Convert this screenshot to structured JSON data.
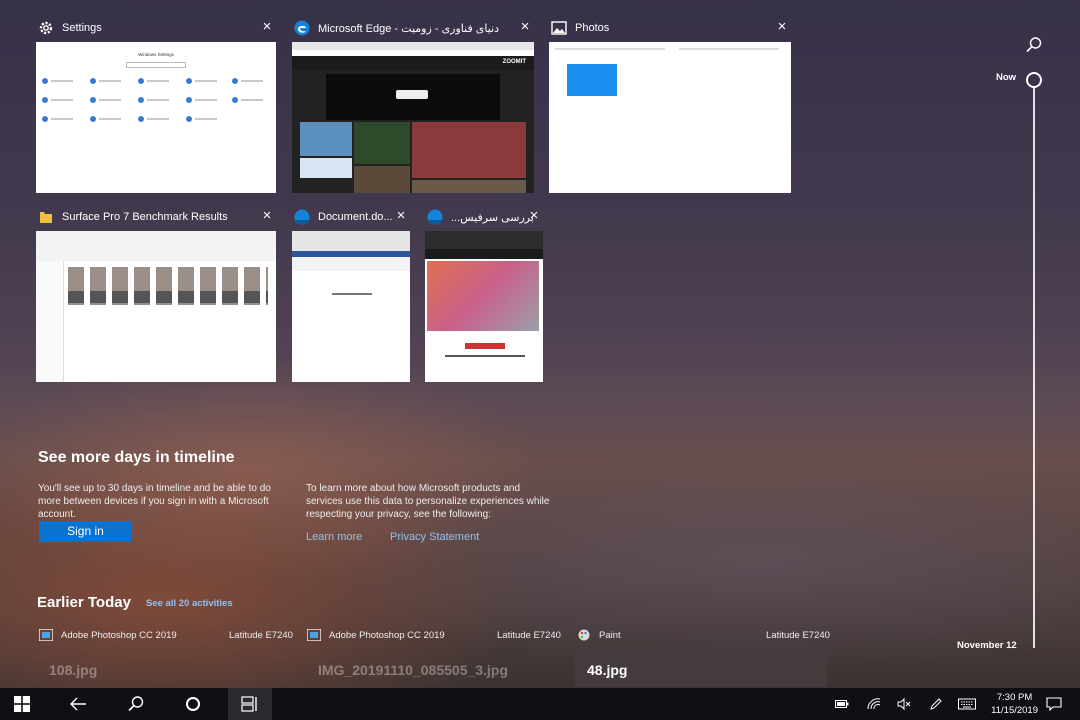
{
  "cards": [
    {
      "title": "Settings",
      "thumb_title": "Windows Settings"
    },
    {
      "title": "دنیای فناوری - زومیت - Microsoft Edge",
      "thumb_brand": "ZOOMIT"
    },
    {
      "title": "Photos"
    },
    {
      "title": "Surface Pro 7 Benchmark Results"
    },
    {
      "title": "Document.do..."
    },
    {
      "title": "بررسی سرفیس..."
    }
  ],
  "signin_panel": {
    "heading": "See more days in timeline",
    "body": "You'll see up to 30 days in timeline and be able to do more between devices if you sign in with a Microsoft account.",
    "sign_in_label": "Sign in",
    "privacy_text": "To learn more about how Microsoft products and services use this data to personalize experiences while respecting your privacy, see the following:",
    "learn_more": "Learn more",
    "privacy_statement": "Privacy Statement"
  },
  "earlier_today": {
    "title": "Earlier Today",
    "see_all": "See all 20 activities",
    "activities": [
      {
        "app": "Adobe Photoshop CC 2019",
        "device": "Latitude E7240",
        "file": "108.jpg"
      },
      {
        "app": "Adobe Photoshop CC 2019",
        "device": "Latitude E7240",
        "file": "IMG_20191110_085505_3.jpg"
      },
      {
        "app": "Paint",
        "device": "Latitude E7240",
        "file": "48.jpg"
      }
    ]
  },
  "timeline": {
    "now": "Now",
    "date": "November 12"
  },
  "taskbar": {
    "time": "7:30 PM",
    "date": "11/15/2019"
  },
  "colors": {
    "accent": "#0a73d0",
    "link": "#8fc2f0",
    "taskbar": "#101014"
  }
}
